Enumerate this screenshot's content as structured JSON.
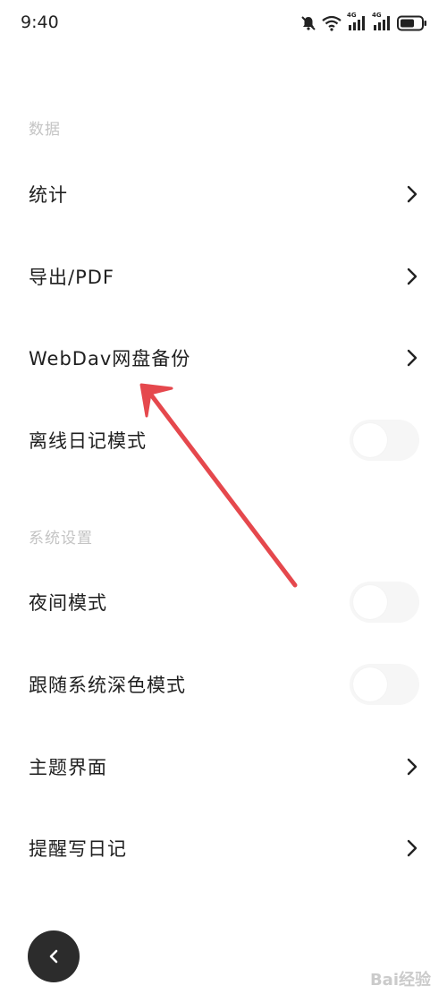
{
  "status_bar": {
    "time": "9:40",
    "network_1": "4G",
    "network_2": "4G"
  },
  "sections": [
    {
      "header": "数据",
      "items": [
        {
          "label": "统计",
          "control": "chevron"
        },
        {
          "label": "导出/PDF",
          "control": "chevron"
        },
        {
          "label": "WebDav网盘备份",
          "control": "chevron"
        },
        {
          "label": "离线日记模式",
          "control": "toggle",
          "enabled": false
        }
      ]
    },
    {
      "header": "系统设置",
      "items": [
        {
          "label": "夜间模式",
          "control": "toggle",
          "enabled": false
        },
        {
          "label": "跟随系统深色模式",
          "control": "toggle",
          "enabled": false
        },
        {
          "label": "主题界面",
          "control": "chevron"
        },
        {
          "label": "提醒写日记",
          "control": "chevron"
        }
      ]
    }
  ],
  "back_button": {
    "icon": "chevron-left-icon"
  },
  "annotation": {
    "color": "#e5484d",
    "target": "WebDav网盘备份"
  },
  "watermark": "Bai经验",
  "colors": {
    "section_header": "#c4c4c4",
    "label": "#1f1f1f",
    "toggle_track": "#f6f6f6",
    "fab": "#2c2c2c"
  }
}
